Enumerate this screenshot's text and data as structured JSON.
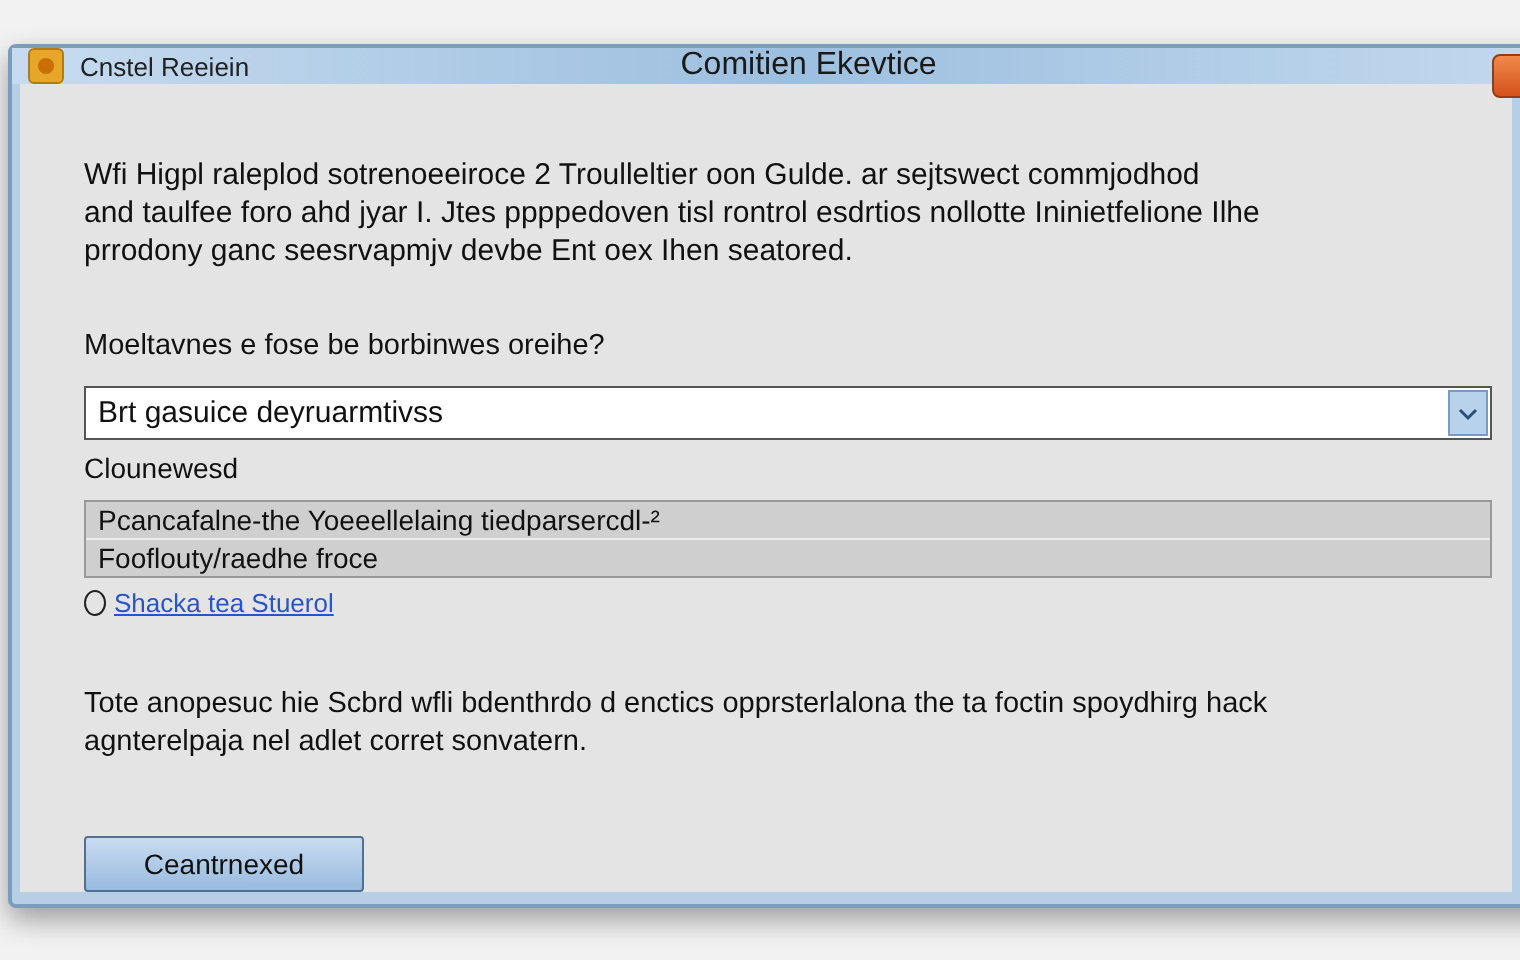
{
  "window": {
    "title_left": "Cnstel Reeiein",
    "title": "Comitien Ekevtice"
  },
  "intro": [
    "Wfi Higpl raleplod sotrenoeeiroce  2 Troulleltier oon Gulde. ar sejtswect commjodhod",
    "and taulfee foro ahd jyar I. Jtes ppppedoven tisl rontrol esdrtios nollotte Ininietfelione Ilhe",
    "prrodony ganc seesrvapmjv devbe Ent oex Ihen seatored."
  ],
  "question": "Moeltavnes e fose be borbinwes oreihe?",
  "dropdown": {
    "value": "Brt gasuice deyruarmtivss"
  },
  "option_label": "Clounewesd",
  "list": {
    "items": [
      {
        "text": "Pcancafalne-the Yoeeellelaing tiedparsercdl-²",
        "selected": false
      },
      {
        "text": "Fooflouty/raedhe froce",
        "selected": false
      }
    ]
  },
  "link": {
    "text": "Shacka tea Stuerol",
    "checked": false
  },
  "note": [
    "Tote anopesuc hie Scbrd wfli bdenthrdo d enctics opprsterlalona the ta foctin spoydhirg hack",
    "agnterelpaja nel adlet corret sonvatern."
  ],
  "buttons": [
    {
      "label": "Ceantrnexed"
    }
  ]
}
